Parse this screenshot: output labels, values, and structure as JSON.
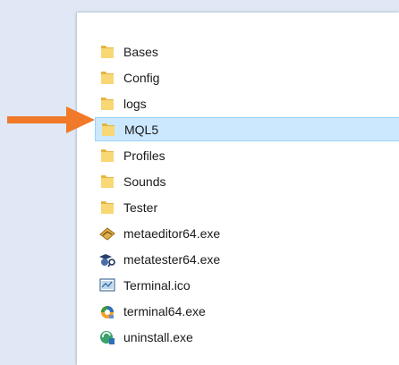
{
  "explorer": {
    "items": [
      {
        "label": "Bases",
        "icon": "folder-icon"
      },
      {
        "label": "Config",
        "icon": "folder-icon"
      },
      {
        "label": "logs",
        "icon": "folder-icon"
      },
      {
        "label": "MQL5",
        "icon": "folder-icon",
        "selected": true
      },
      {
        "label": "Profiles",
        "icon": "folder-icon"
      },
      {
        "label": "Sounds",
        "icon": "folder-icon"
      },
      {
        "label": "Tester",
        "icon": "folder-icon"
      },
      {
        "label": "metaeditor64.exe",
        "icon": "metaeditor-icon"
      },
      {
        "label": "metatester64.exe",
        "icon": "metatester-icon"
      },
      {
        "label": "Terminal.ico",
        "icon": "terminal-ico-icon"
      },
      {
        "label": "terminal64.exe",
        "icon": "terminal-exe-icon"
      },
      {
        "label": "uninstall.exe",
        "icon": "uninstall-icon"
      }
    ]
  },
  "annotation": {
    "icon": "arrow-right-icon",
    "color": "#f07a2a"
  },
  "colors": {
    "selection_bg": "#cce8ff",
    "selection_border": "#99d1ff",
    "folder": "#f8d775"
  }
}
